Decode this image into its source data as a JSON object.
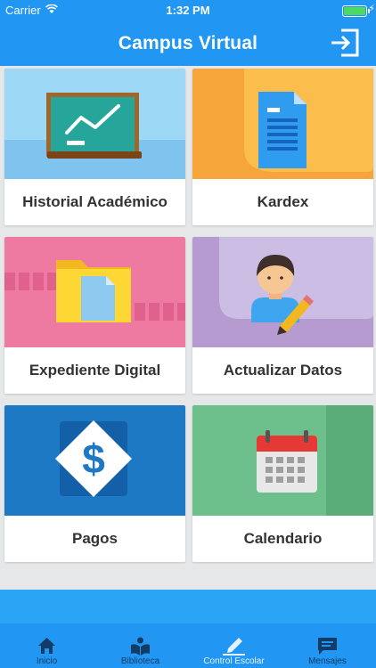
{
  "status_bar": {
    "carrier": "Carrier",
    "time": "1:32 PM"
  },
  "header": {
    "title": "Campus Virtual",
    "logout_icon": "logout-icon"
  },
  "tiles": [
    {
      "label": "Historial Académico",
      "icon": "chalkboard-chart-icon",
      "bg": "#7ec7ef"
    },
    {
      "label": "Kardex",
      "icon": "document-icon",
      "bg": "#f6a53a"
    },
    {
      "label": "Expediente Digital",
      "icon": "folder-icon",
      "bg": "#ee7aa2"
    },
    {
      "label": "Actualizar Datos",
      "icon": "user-edit-icon",
      "bg": "#b59bd0"
    },
    {
      "label": "Pagos",
      "icon": "dollar-icon",
      "bg": "#1e79c4"
    },
    {
      "label": "Calendario",
      "icon": "calendar-icon",
      "bg": "#6dc08c"
    }
  ],
  "tabbar": {
    "items": [
      {
        "label": "Inicio",
        "icon": "home-icon"
      },
      {
        "label": "Biblioteca",
        "icon": "book-reader-icon"
      },
      {
        "label": "Control Escolar",
        "icon": "pencil-icon",
        "selected": true
      },
      {
        "label": "Mensajes",
        "icon": "message-icon"
      }
    ]
  }
}
